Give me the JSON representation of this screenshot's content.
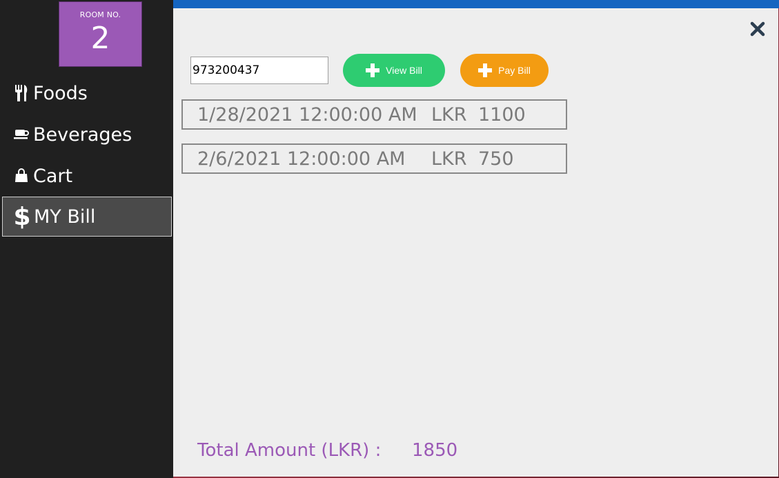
{
  "room": {
    "label": "ROOM NO.",
    "number": "2"
  },
  "nav": {
    "items": [
      {
        "label": "Foods",
        "icon": "utensils-icon"
      },
      {
        "label": "Beverages",
        "icon": "coffee-cup-icon"
      },
      {
        "label": "Cart",
        "icon": "shopping-bag-icon"
      },
      {
        "label": "MY Bill",
        "icon": "dollar-icon",
        "active": true
      }
    ]
  },
  "search": {
    "value": "973200437"
  },
  "buttons": {
    "view_bill": "View Bill",
    "pay_bill": "Pay Bill"
  },
  "bills": [
    {
      "date": "1/28/2021 12:00:00 AM",
      "currency": "LKR",
      "amount": "1100"
    },
    {
      "date": "2/6/2021 12:00:00 AM",
      "currency": "LKR",
      "amount": "750"
    }
  ],
  "total": {
    "label": "Total Amount (LKR) :",
    "value": "1850"
  },
  "colors": {
    "sidebar": "#202020",
    "room_tile": "#9b59b6",
    "view_button": "#2ecc71",
    "pay_button": "#f39c12",
    "total_text": "#9b59b6",
    "title_bar": "#1565c0"
  }
}
